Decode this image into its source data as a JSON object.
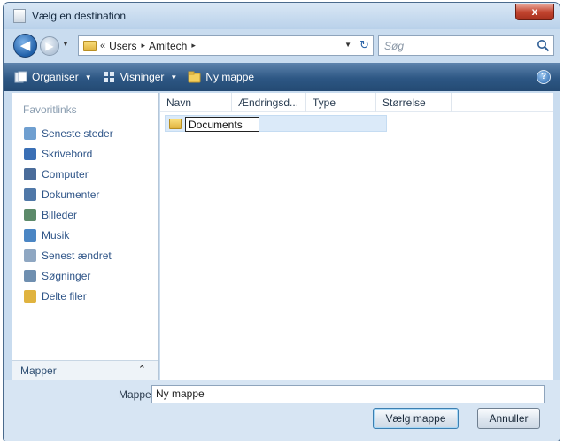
{
  "window": {
    "title": "Vælg en destination",
    "close_label": "x"
  },
  "address": {
    "chevron": "«",
    "crumbs": [
      "Users",
      "Amitech"
    ],
    "separator": "▸",
    "refresh_glyph": "↻"
  },
  "search": {
    "placeholder": "Søg"
  },
  "toolbar": {
    "organize_label": "Organiser",
    "views_label": "Visninger",
    "new_folder_label": "Ny mappe",
    "help_glyph": "?"
  },
  "navpane": {
    "header": "Favoritlinks",
    "items": [
      {
        "label": "Seneste steder",
        "icon": "recent-places-icon",
        "color": "#6f9fd0"
      },
      {
        "label": "Skrivebord",
        "icon": "desktop-icon",
        "color": "#3a6fb5"
      },
      {
        "label": "Computer",
        "icon": "computer-icon",
        "color": "#4a6c9a"
      },
      {
        "label": "Dokumenter",
        "icon": "documents-icon",
        "color": "#5078a8"
      },
      {
        "label": "Billeder",
        "icon": "pictures-icon",
        "color": "#5c8a6a"
      },
      {
        "label": "Musik",
        "icon": "music-icon",
        "color": "#4b86c4"
      },
      {
        "label": "Senest ændret",
        "icon": "recently-changed-icon",
        "color": "#8fa7c2"
      },
      {
        "label": "Søgninger",
        "icon": "searches-icon",
        "color": "#6f8fb0"
      },
      {
        "label": "Delte filer",
        "icon": "shared-folder-icon",
        "color": "#e0b33f"
      }
    ],
    "folders_label": "Mapper",
    "folders_caret": "⌃"
  },
  "filelist": {
    "columns": [
      "Navn",
      "Ændringsd...",
      "Type",
      "Størrelse"
    ],
    "rows": [
      {
        "name": "Documents",
        "editing": true
      }
    ]
  },
  "footer": {
    "folder_label": "Mappe:",
    "folder_value": "Ny mappe",
    "select_button": "Vælg mappe",
    "cancel_button": "Annuller"
  }
}
